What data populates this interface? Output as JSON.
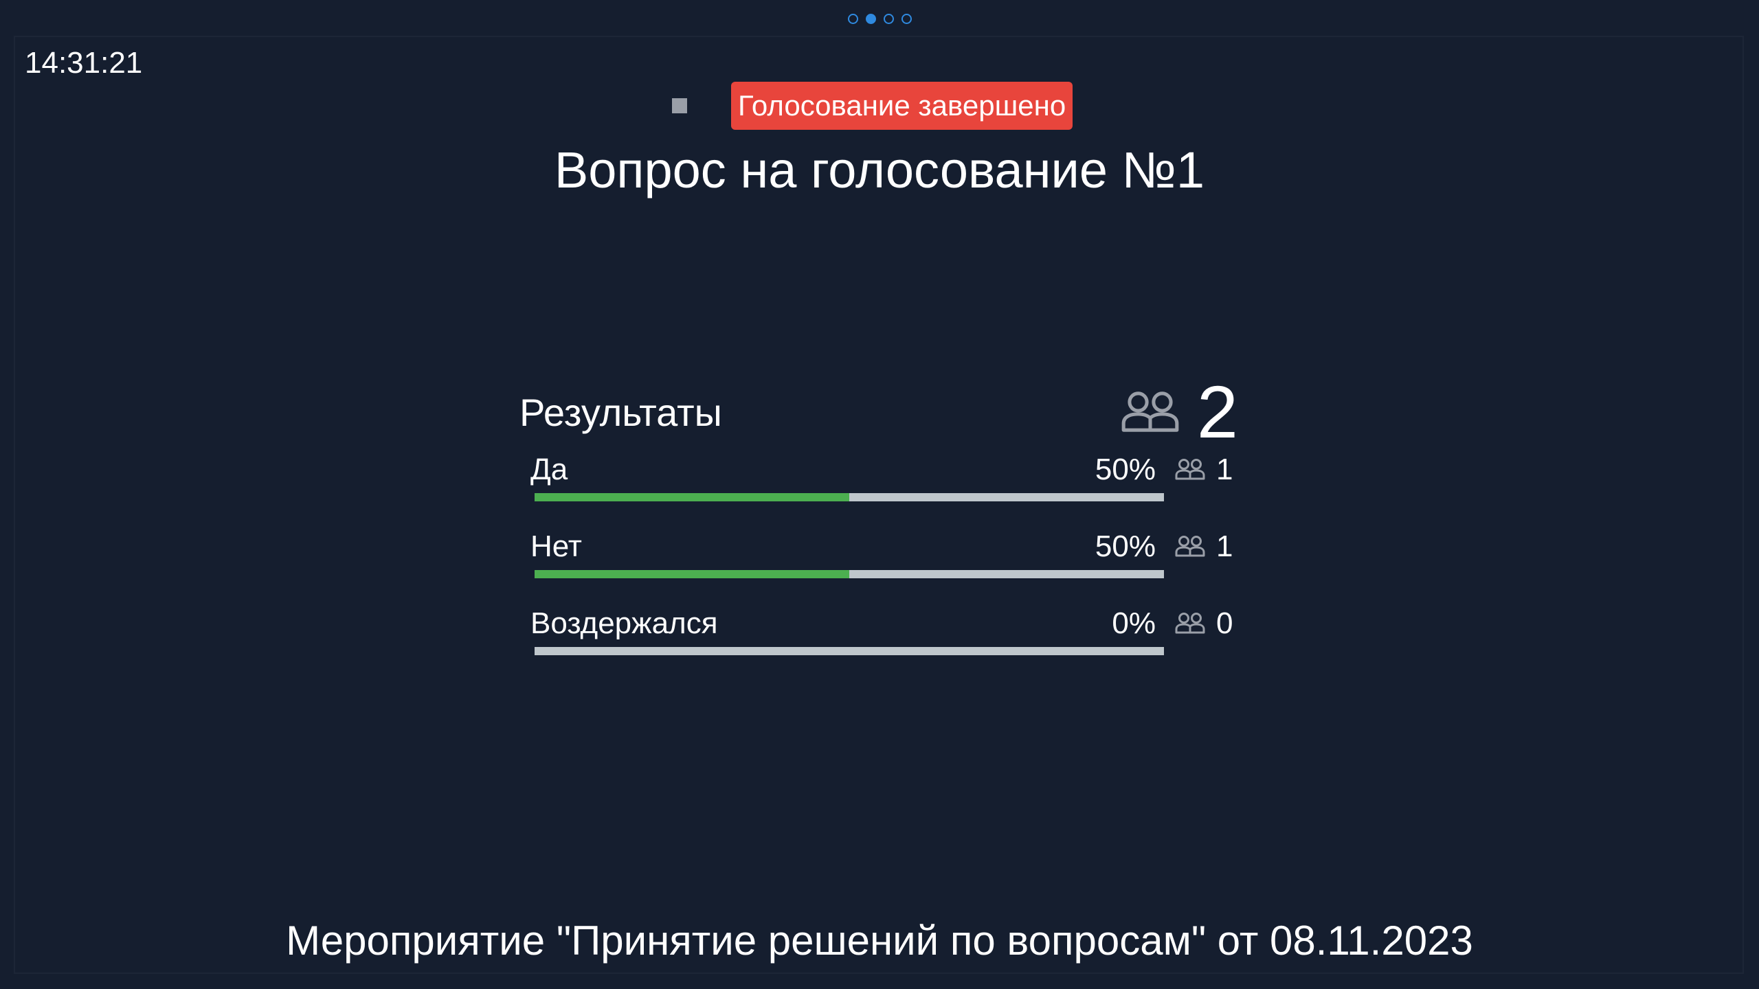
{
  "pager": {
    "pages": 4,
    "active_index": 1
  },
  "clock": "14:31:21",
  "status": {
    "badge_label": "Голосование завершено",
    "badge_color": "#e8453c",
    "stop_icon": "stop-square-icon"
  },
  "question": {
    "title": "Вопрос на голосование №1"
  },
  "results": {
    "title": "Результаты",
    "total_icon": "people-icon",
    "total_voters": "2",
    "options": [
      {
        "label": "Да",
        "percent_text": "50%",
        "fraction": 0.5,
        "count": "1"
      },
      {
        "label": "Нет",
        "percent_text": "50%",
        "fraction": 0.5,
        "count": "1"
      },
      {
        "label": "Воздержался",
        "percent_text": "0%",
        "fraction": 0.0,
        "count": "0"
      }
    ]
  },
  "colors": {
    "background": "#151e2f",
    "bar_fill": "#4caf50",
    "bar_track": "#bfc7cc",
    "pager_dot": "#2f8ae0"
  },
  "footer": {
    "event": "Мероприятие \"Принятие решений по вопросам\" от 08.11.2023"
  }
}
